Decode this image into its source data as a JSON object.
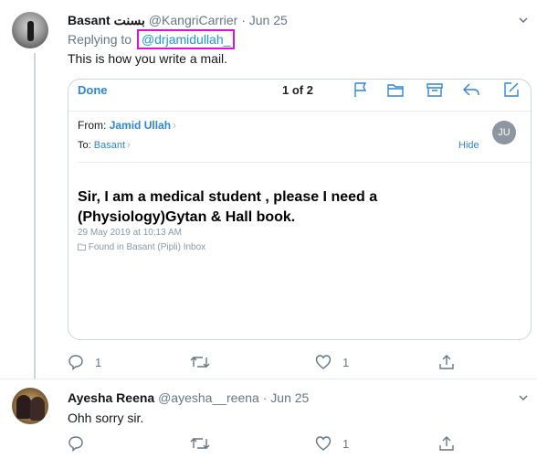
{
  "tweets": [
    {
      "name": "Basant بسنت",
      "handle": "@KangriCarrier",
      "separator": "·",
      "date": "Jun 25",
      "replying_prefix": "Replying to",
      "replying_to": "@drjamidullah_",
      "text": "This is how you write a mail.",
      "counts": {
        "reply": "1",
        "retweet": "",
        "like": "1",
        "share": ""
      }
    },
    {
      "name": "Ayesha Reena",
      "handle": "@ayesha__reena",
      "separator": "·",
      "date": "Jun 25",
      "text": "Ohh sorry sir.",
      "counts": {
        "reply": "",
        "retweet": "",
        "like": "1",
        "share": ""
      }
    }
  ],
  "mail": {
    "done_label": "Done",
    "page_indicator": "1 of 2",
    "from_label": "From:",
    "from_name": "Jamid Ullah",
    "to_label": "To:",
    "to_name": "Basant",
    "initials": "JU",
    "hide_label": "Hide",
    "subject": "Sir, I am a medical student , please I need a (Physiology)Gytan & Hall book.",
    "date": "29 May 2019 at 10:13 AM",
    "found_in": "Found in Basant (Pipli) Inbox",
    "toolbar_icons": [
      "flag-icon",
      "folder-icon",
      "archive-icon",
      "reply-icon",
      "compose-icon"
    ]
  },
  "colors": {
    "link": "#1b95e0",
    "mail_accent": "#2f86d5",
    "secondary_text": "#657786",
    "highlight_box": "#e014d0"
  }
}
